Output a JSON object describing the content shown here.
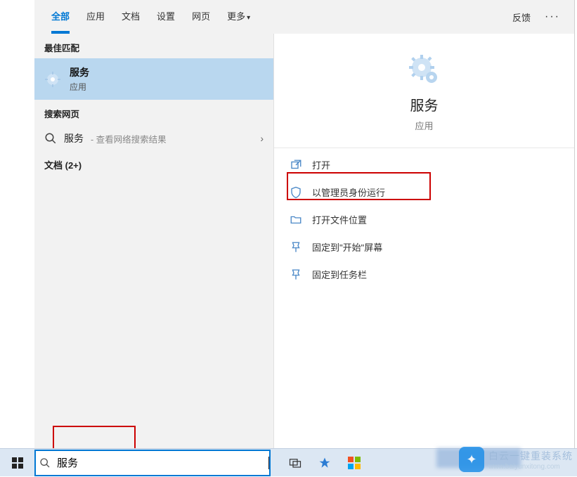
{
  "tabs": {
    "all": "全部",
    "apps": "应用",
    "docs": "文档",
    "settings": "设置",
    "web": "网页",
    "more": "更多"
  },
  "header": {
    "feedback": "反馈"
  },
  "left": {
    "best_match_header": "最佳匹配",
    "best_match": {
      "title": "服务",
      "subtitle": "应用"
    },
    "search_web_header": "搜索网页",
    "web_query": "服务",
    "web_hint": " - 查看网络搜索结果",
    "documents": "文档 (2+)"
  },
  "right": {
    "title": "服务",
    "subtitle": "应用",
    "actions": {
      "open": "打开",
      "run_admin": "以管理员身份运行",
      "open_location": "打开文件位置",
      "pin_start": "固定到\"开始\"屏幕",
      "pin_taskbar": "固定到任务栏"
    }
  },
  "search": {
    "value": "服务"
  },
  "watermark": {
    "line1": "白云一键重装系统",
    "line2": "www.baiyunxitong.com"
  }
}
